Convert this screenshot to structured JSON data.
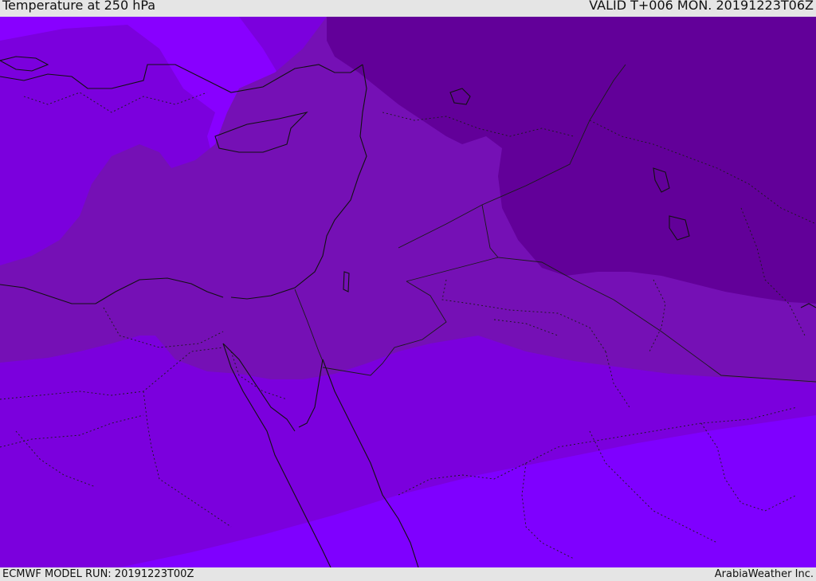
{
  "header": {
    "title": "Temperature at 250 hPa",
    "valid": "VALID T+006 MON. 20191223T06Z"
  },
  "footer": {
    "model_run": "ECMWF MODEL RUN: 20191223T00Z",
    "credit": "ArabiaWeather Inc."
  },
  "map": {
    "field": "temperature",
    "level": "250 hPa",
    "colors": {
      "coldest": "#620099",
      "cold": "#7510b5",
      "mid": "#7b00dd",
      "warm": "#7f00ff",
      "warmest": "#8800ff",
      "coastline": "#111111",
      "border": "#1a1a1a"
    }
  }
}
